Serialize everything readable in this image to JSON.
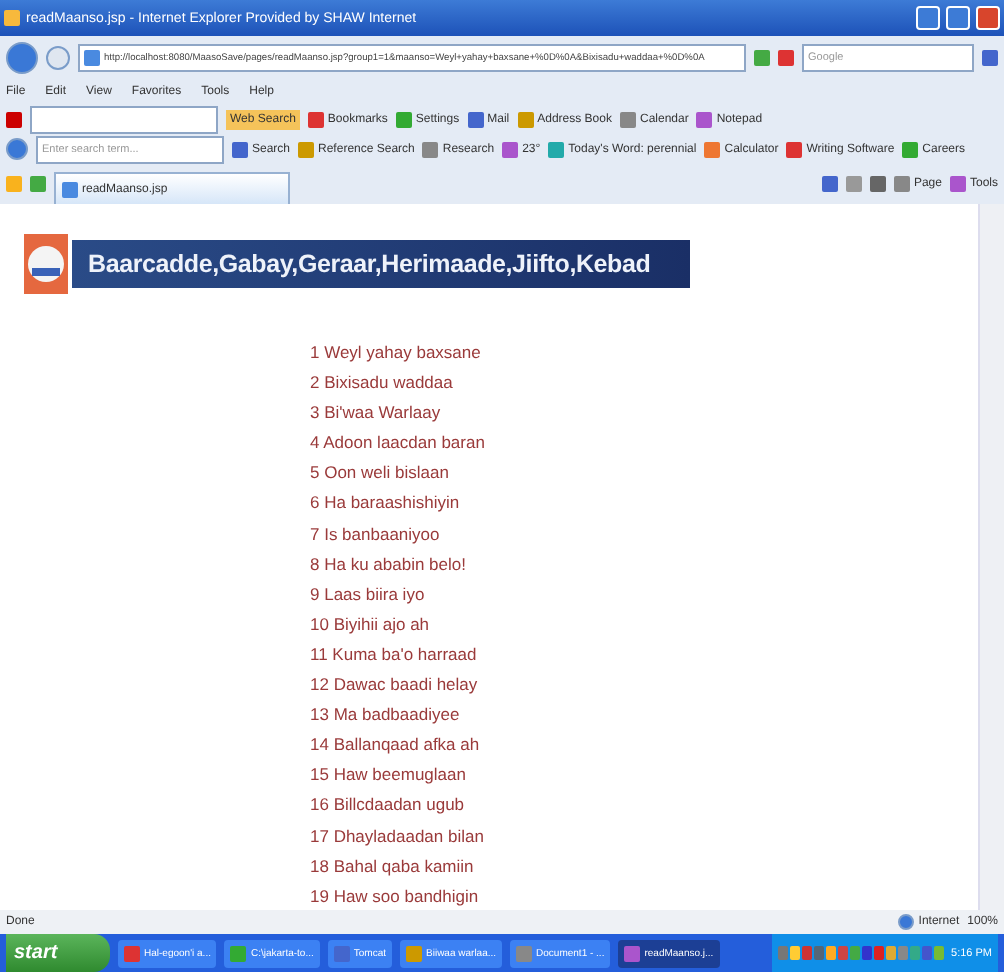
{
  "window": {
    "title": "readMaanso.jsp - Internet Explorer Provided by SHAW Internet"
  },
  "address_bar": {
    "url": "http://localhost:8080/MaasoSave/pages/readMaanso.jsp?group1=1&maanso=Weyl+yahay+baxsane+%0D%0A&Bixisadu+waddaa+%0D%0A",
    "search_placeholder": "Google"
  },
  "menu": [
    "File",
    "Edit",
    "View",
    "Favorites",
    "Tools",
    "Help"
  ],
  "yahoo_toolbar": {
    "search_button": "Web Search",
    "items": [
      "Bookmarks",
      "Settings",
      "Mail",
      "Address Book",
      "Calendar",
      "Notepad"
    ]
  },
  "second_toolbar": {
    "search_placeholder": "Enter search term...",
    "items": [
      "Search",
      "Reference Search",
      "Research",
      "23°",
      "Today's Word: perennial",
      "Calculator",
      "Writing Software",
      "Careers"
    ]
  },
  "tabs": [
    {
      "label": "readMaanso.jsp",
      "selected": true
    }
  ],
  "command_bar": [
    "Page",
    "Tools"
  ],
  "page": {
    "banner": "Baarcadde,Gabay,Geraar,Herimaade,Jiifto,Kebad",
    "poems": [
      "1 Weyl yahay baxsane",
      "2 Bixisadu waddaa",
      "3 Bi'waa Warlaay",
      "4 Adoon laacdan baran",
      "5 Oon weli bislaan",
      "6 Ha baraashishiyin",
      "7 Is banbaaniyoo",
      "8 Ha ku ababin belo!",
      "9 Laas biira iyo",
      "10 Biyihii ajo ah",
      "11 Kuma ba'o harraad",
      "12 Dawac baadi helay",
      "13 Ma badbaadiyee",
      "14 Ballanqaad afka ah",
      "15 Haw beemuglaan",
      "16 Billcdaadan ugub",
      "17 Dhayladaadan bilan",
      "18 Bahal qaba kamiin",
      "19 Haw soo bandhigin"
    ]
  },
  "status_bar": {
    "text": "Done",
    "zone": "Internet",
    "zoom": "100%"
  },
  "taskbar": {
    "start": "start",
    "tasks": [
      {
        "label": "Hal-egoon'i a...",
        "selected": false
      },
      {
        "label": "C:\\jakarta-to...",
        "selected": false
      },
      {
        "label": "Tomcat",
        "selected": false
      },
      {
        "label": "Biiwaa warlaa...",
        "selected": false
      },
      {
        "label": "Document1 - ...",
        "selected": false
      },
      {
        "label": "readMaanso.j...",
        "selected": true
      }
    ],
    "clock": "5:16 PM"
  }
}
